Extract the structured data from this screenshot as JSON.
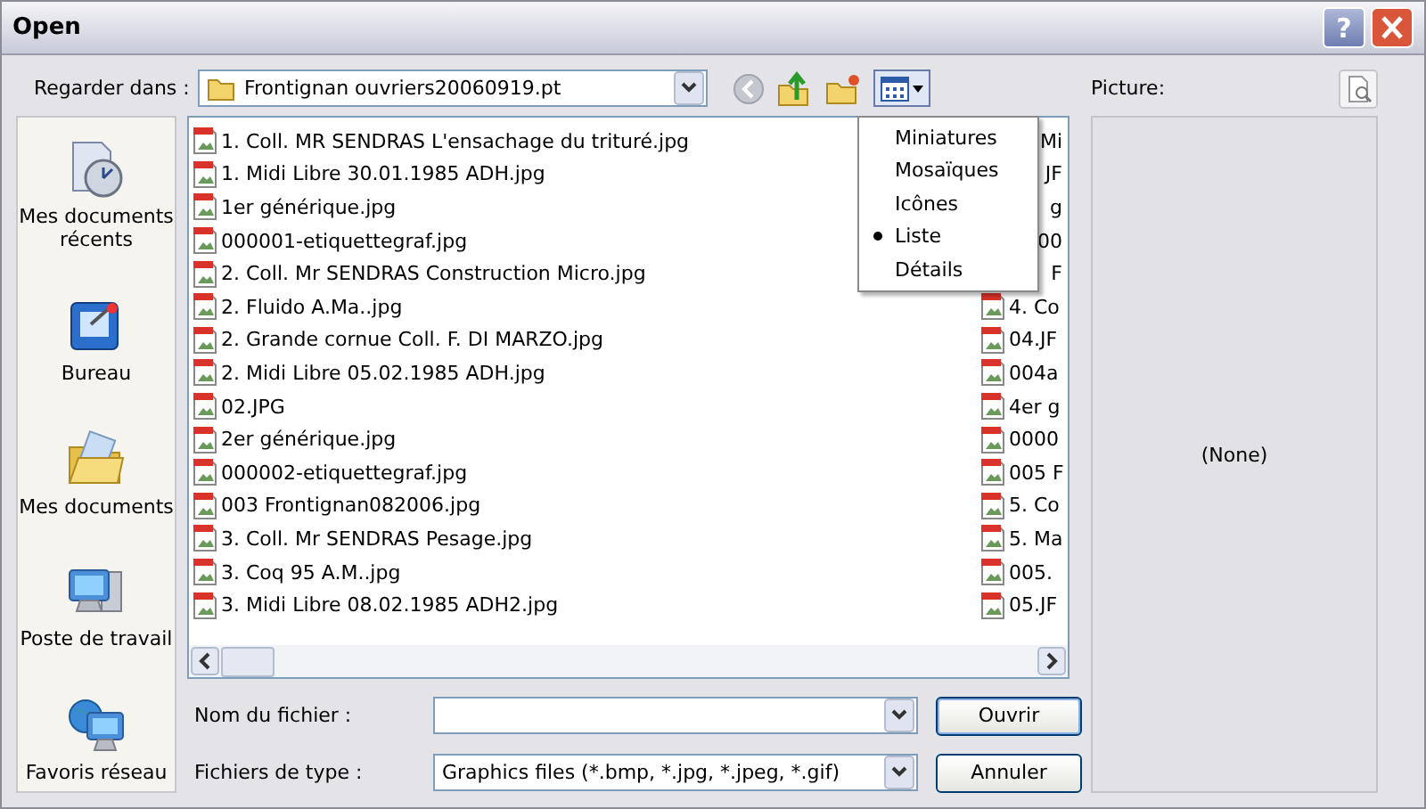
{
  "window": {
    "title": "Open",
    "help_button": "?"
  },
  "look_in": {
    "label": "Regarder dans :",
    "value": "Frontignan ouvriers20060919.pt"
  },
  "view_menu": [
    {
      "label": "Miniatures",
      "selected": false
    },
    {
      "label": "Mosaïques",
      "selected": false
    },
    {
      "label": "Icônes",
      "selected": false
    },
    {
      "label": "Liste",
      "selected": true
    },
    {
      "label": "Détails",
      "selected": false
    }
  ],
  "places": [
    {
      "label": "Mes documents récents",
      "kind": "recent"
    },
    {
      "label": "Bureau",
      "kind": "desktop"
    },
    {
      "label": "Mes documents",
      "kind": "documents"
    },
    {
      "label": "Poste de travail",
      "kind": "computer"
    },
    {
      "label": "Favoris réseau",
      "kind": "network"
    }
  ],
  "file_columns": [
    [
      {
        "name": "1. Coll. MR SENDRAS L'ensachage du trituré.jpg",
        "kind": "file"
      },
      {
        "name": "1. Midi Libre 30.01.1985 ADH.jpg",
        "kind": "file"
      },
      {
        "name": "1er générique.jpg",
        "kind": "file"
      },
      {
        "name": "000001-etiquettegraf.jpg",
        "kind": "file"
      },
      {
        "name": "2. Coll. Mr SENDRAS Construction Micro.jpg",
        "kind": "file"
      },
      {
        "name": "2. Fluido A.Ma..jpg",
        "kind": "file"
      },
      {
        "name": "2. Grande cornue  Coll. F. DI MARZO.jpg",
        "kind": "file"
      },
      {
        "name": "2. Midi Libre 05.02.1985 ADH.jpg",
        "kind": "file"
      },
      {
        "name": "02.JPG",
        "kind": "file"
      },
      {
        "name": "2er générique.jpg",
        "kind": "file"
      },
      {
        "name": "000002-etiquettegraf.jpg",
        "kind": "file"
      },
      {
        "name": "003 Frontignan082006.jpg",
        "kind": "file"
      },
      {
        "name": "3. Coll. Mr SENDRAS Pesage.jpg",
        "kind": "file"
      },
      {
        "name": "3. Coq 95 A.M..jpg",
        "kind": "file"
      },
      {
        "name": "3. Midi Libre 08.02.1985 ADH2.jpg",
        "kind": "file"
      }
    ],
    [
      {
        "name": "Mi",
        "kind": "covered"
      },
      {
        "name": "JF",
        "kind": "covered"
      },
      {
        "name": "g",
        "kind": "covered"
      },
      {
        "name": "00",
        "kind": "covered"
      },
      {
        "name": "F",
        "kind": "covered"
      },
      {
        "name": "4. Co",
        "kind": "file"
      },
      {
        "name": "04.JF",
        "kind": "file"
      },
      {
        "name": "004a",
        "kind": "file"
      },
      {
        "name": "4er g",
        "kind": "file"
      },
      {
        "name": "0000",
        "kind": "file"
      },
      {
        "name": "005 F",
        "kind": "file"
      },
      {
        "name": "5. Co",
        "kind": "file"
      },
      {
        "name": "5. Ma",
        "kind": "file"
      },
      {
        "name": "005.",
        "kind": "file"
      },
      {
        "name": "05.JF",
        "kind": "file"
      }
    ]
  ],
  "file_name": {
    "label": "Nom du fichier :"
  },
  "file_type": {
    "label": "Fichiers de type :",
    "value": "Graphics files (*.bmp, *.jpg, *.jpeg, *.gif)"
  },
  "buttons": {
    "open": "Ouvrir",
    "cancel": "Annuler"
  },
  "preview": {
    "label": "Picture:",
    "text": "(None)"
  }
}
